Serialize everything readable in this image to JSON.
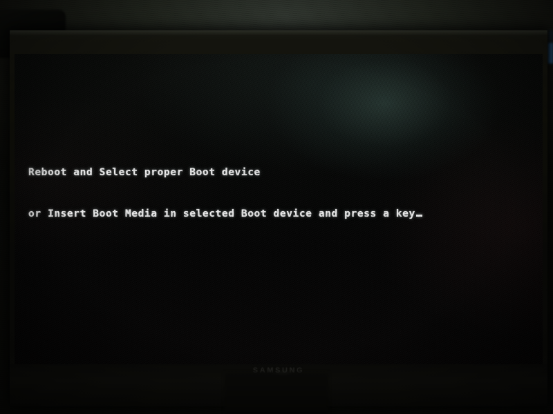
{
  "scene": {
    "kind": "photograph-of-monitor",
    "room_background_color": "#23271f",
    "monitor_body_color": "#10100a"
  },
  "monitor": {
    "screen": {
      "background_color": "#050505",
      "backlight_bloom_color": "#486860",
      "text_color": "#f2f2f2"
    },
    "bezel": {
      "brand_logo": "SAMSUNG",
      "power_led": {
        "name": "power-led",
        "color": "#fdfdfb",
        "state": "on"
      }
    }
  },
  "bios": {
    "lines": [
      "Reboot and Select proper Boot device",
      "or Insert Boot Media in selected Boot device and press a key"
    ],
    "line1": "Reboot and Select proper Boot device",
    "line2": "or Insert Boot Media in selected Boot device and press a key",
    "cursor": "_"
  },
  "indicators": {
    "blue_edge_glow_color": "#3b85c6"
  }
}
